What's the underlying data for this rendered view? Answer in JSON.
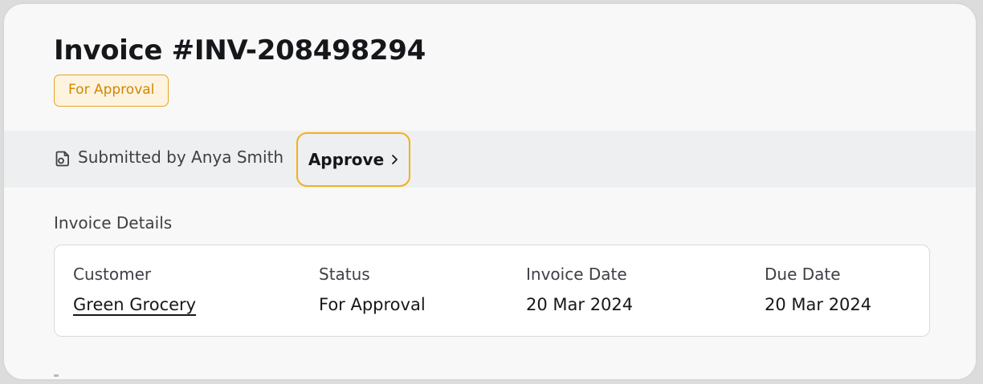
{
  "invoice": {
    "title": "Invoice #INV-208498294",
    "status_badge": "For Approval"
  },
  "submission": {
    "icon": "document-icon",
    "text": "Submitted by Anya Smith",
    "approve_label": "Approve",
    "approve_icon": "chevron-right-icon"
  },
  "details": {
    "section_title": "Invoice Details",
    "customer_label": "Customer",
    "customer_value": "Green Grocery",
    "status_label": "Status",
    "status_value": "For Approval",
    "invoice_date_label": "Invoice Date",
    "invoice_date_value": "20 Mar 2024",
    "due_date_label": "Due Date",
    "due_date_value": "20 Mar 2024"
  },
  "colors": {
    "badge_border": "#e6a524",
    "badge_text": "#d08800",
    "approve_focus_ring": "#f2b11a",
    "bar_background": "#eeeff0"
  }
}
